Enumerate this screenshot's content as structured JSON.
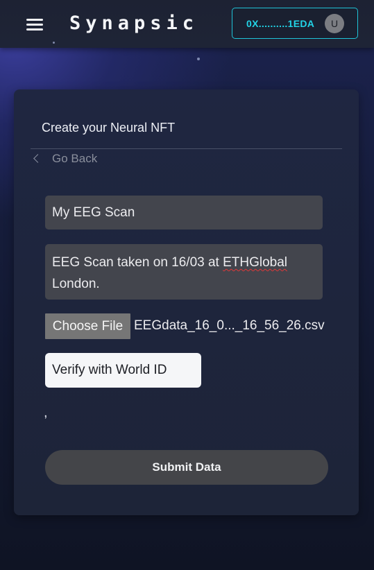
{
  "header": {
    "brand": "Synapsic",
    "wallet_address": "0X..........1EDA",
    "avatar_initial": "U",
    "accent_color": "#22d3e6"
  },
  "form": {
    "title": "Create your Neural NFT",
    "back_label": "Go Back",
    "name_value": "My EEG Scan",
    "description_prefix": "EEG Scan taken on 16/03 at ",
    "description_misspelled": "ETHGlobal",
    "description_suffix": " London.",
    "choose_file_label": "Choose File",
    "file_name": "EEGdata_16_0..._16_56_26.csv",
    "verify_label": "Verify with World ID",
    "status_text": ",",
    "submit_label": "Submit Data"
  },
  "icons": {
    "menu": "hamburger-menu-icon",
    "back": "chevron-left-icon"
  }
}
